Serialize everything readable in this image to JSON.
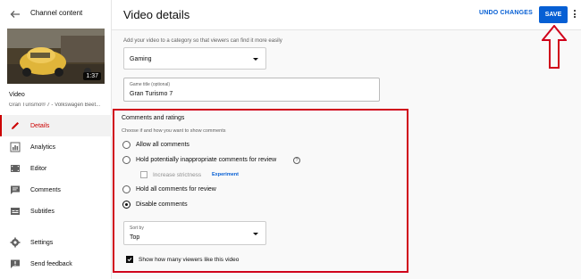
{
  "sidebar": {
    "title": "Channel content",
    "thumbnail_duration": "1:37",
    "video_label": "Video",
    "video_name": "Gran Turismo® 7 - Volkswagen Beet...",
    "items": [
      {
        "label": "Details",
        "icon": "pencil-icon",
        "active": true
      },
      {
        "label": "Analytics",
        "icon": "analytics-icon",
        "active": false
      },
      {
        "label": "Editor",
        "icon": "editor-icon",
        "active": false
      },
      {
        "label": "Comments",
        "icon": "comments-icon",
        "active": false
      },
      {
        "label": "Subtitles",
        "icon": "subtitles-icon",
        "active": false
      }
    ],
    "settings_label": "Settings",
    "feedback_label": "Send feedback"
  },
  "header": {
    "title": "Video details",
    "undo_label": "UNDO CHANGES",
    "save_label": "SAVE"
  },
  "category": {
    "help": "Add your video to a category so that viewers can find it more easily",
    "value": "Gaming"
  },
  "game_title": {
    "label": "Game title (optional)",
    "value": "Gran Turismo 7"
  },
  "comments": {
    "title": "Comments and ratings",
    "help": "Choose if and how you want to show comments",
    "options": [
      {
        "label": "Allow all comments",
        "selected": false
      },
      {
        "label": "Hold potentially inappropriate comments for review",
        "selected": false
      },
      {
        "label": "Hold all comments for review",
        "selected": false
      },
      {
        "label": "Disable comments",
        "selected": true
      }
    ],
    "strictness_label": "Increase strictness",
    "experiment_label": "Experiment",
    "sort_label": "Sort by",
    "sort_value": "Top",
    "show_likes_label": "Show how many viewers like this video",
    "show_likes_checked": true
  },
  "colors": {
    "accent": "#065fd4",
    "active_nav": "#cc0000",
    "annotation": "#d0021b"
  }
}
